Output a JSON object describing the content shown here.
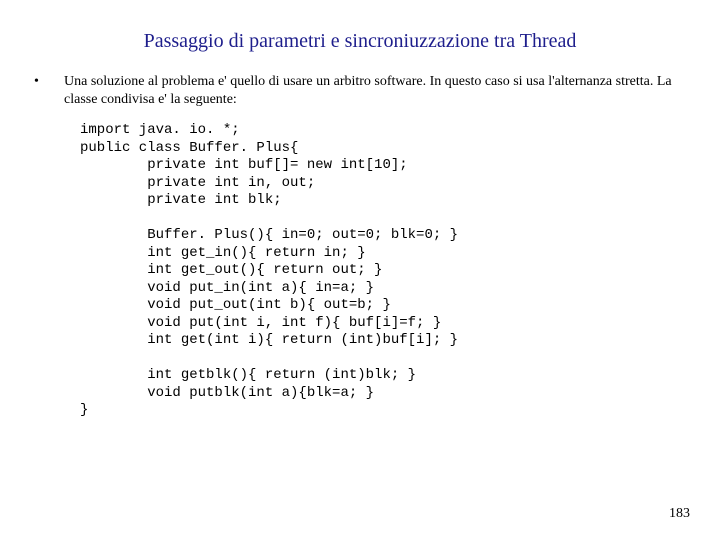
{
  "title": "Passaggio di parametri e sincroniuzzazione tra Thread",
  "bullet": {
    "text": "Una soluzione al problema e' quello di usare un arbitro software. In questo caso si usa l'alternanza stretta. La classe condivisa e' la seguente:"
  },
  "code": "import java. io. *;\npublic class Buffer. Plus{\n        private int buf[]= new int[10];\n        private int in, out;\n        private int blk;\n\n        Buffer. Plus(){ in=0; out=0; blk=0; }\n        int get_in(){ return in; }\n        int get_out(){ return out; }\n        void put_in(int a){ in=a; }\n        void put_out(int b){ out=b; }\n        void put(int i, int f){ buf[i]=f; }\n        int get(int i){ return (int)buf[i]; }\n\n        int getblk(){ return (int)blk; }\n        void putblk(int a){blk=a; }\n}",
  "page_number": "183"
}
